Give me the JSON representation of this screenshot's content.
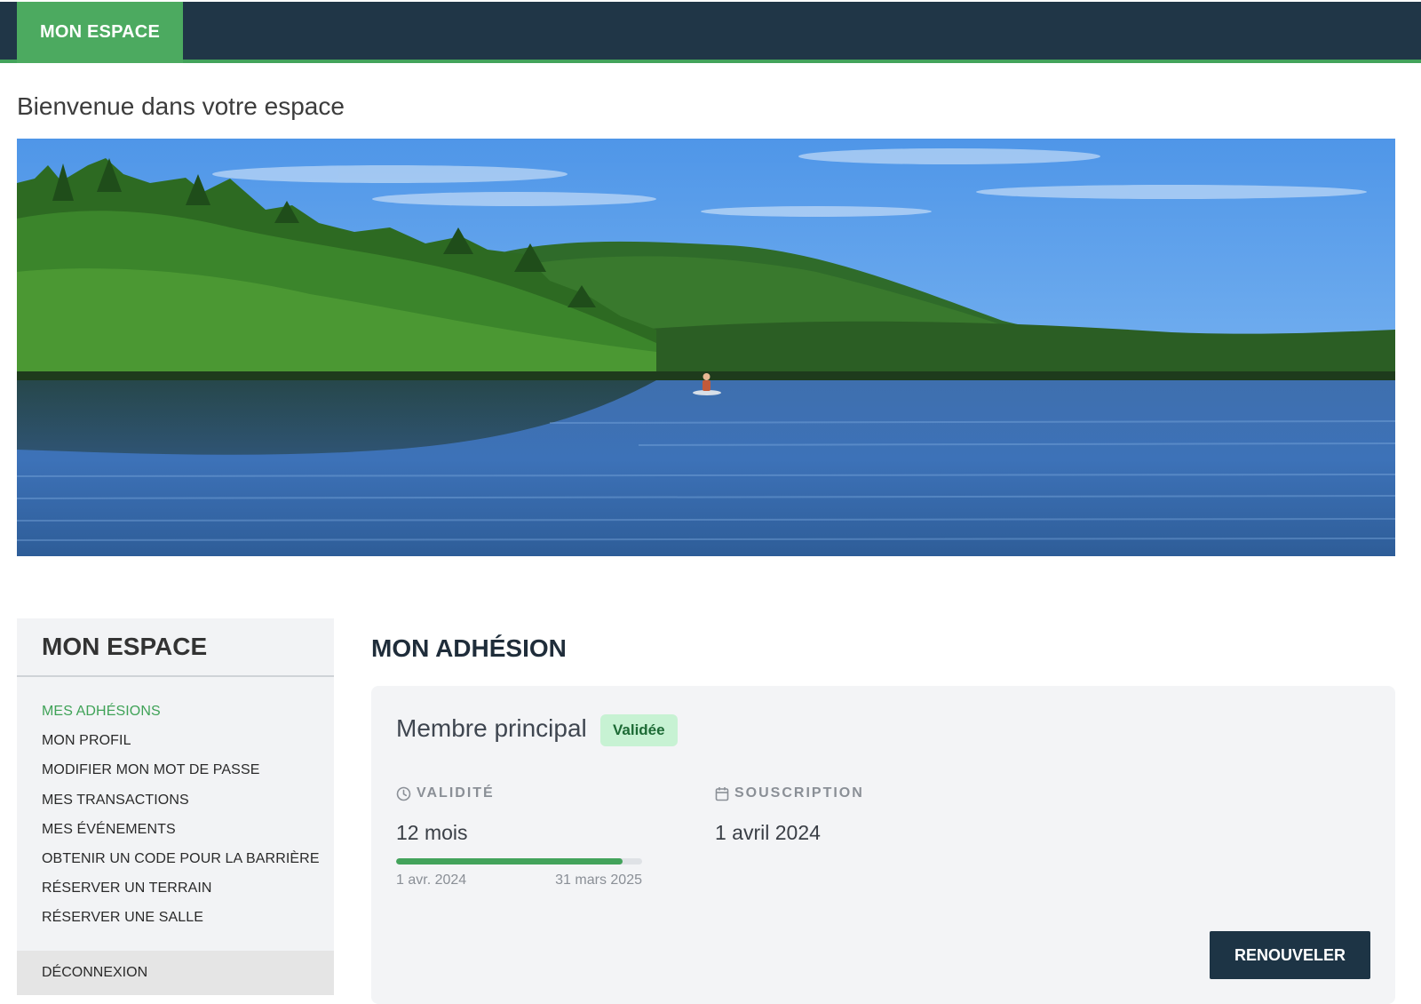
{
  "topbar": {
    "tab_label": "MON ESPACE"
  },
  "welcome": "Bienvenue dans votre espace",
  "hero": {
    "image": "lake-forest-kayak-landscape"
  },
  "sidebar": {
    "title": "MON ESPACE",
    "items": [
      {
        "label": "MES ADHÉSIONS",
        "active": true
      },
      {
        "label": "MON PROFIL"
      },
      {
        "label": "MODIFIER MON MOT DE PASSE"
      },
      {
        "label": "MES TRANSACTIONS"
      },
      {
        "label": "MES ÉVÉNEMENTS"
      },
      {
        "label": "OBTENIR UN CODE POUR LA BARRIÈRE"
      },
      {
        "label": "RÉSERVER UN TERRAIN"
      },
      {
        "label": "RÉSERVER UNE SALLE"
      }
    ],
    "logout": "DÉCONNEXION"
  },
  "main": {
    "title": "MON ADHÉSION",
    "membership": {
      "type": "Membre principal",
      "status": "Validée",
      "validity_label": "VALIDITÉ",
      "validity_value": "12 mois",
      "validity_progress": 0.92,
      "start_date": "1 avr. 2024",
      "end_date": "31 mars 2025",
      "subscription_label": "SOUSCRIPTION",
      "subscription_value": "1 avril 2024",
      "renew_label": "RENOUVELER"
    }
  },
  "colors": {
    "nav_bg": "#203647",
    "accent_green": "#4caa60",
    "badge_bg": "#c7f2d3",
    "button_bg": "#1d3445"
  },
  "icons": {
    "validity": "clock-icon",
    "subscription": "calendar-icon"
  }
}
